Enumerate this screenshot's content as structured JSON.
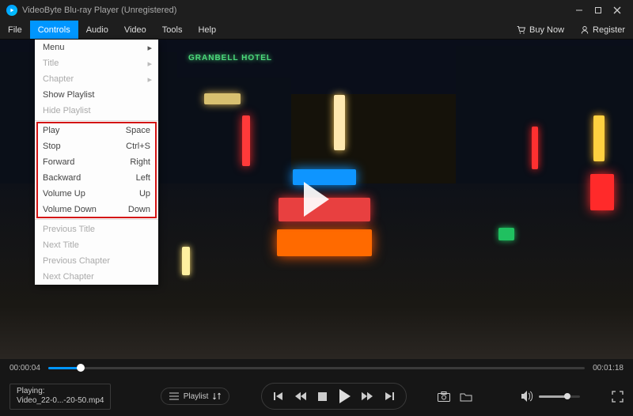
{
  "titlebar": {
    "title": "VideoByte Blu-ray Player (Unregistered)"
  },
  "menubar": {
    "items": [
      "File",
      "Controls",
      "Audio",
      "Video",
      "Tools",
      "Help"
    ],
    "active_index": 1,
    "buy": "Buy Now",
    "register": "Register"
  },
  "dropdown": {
    "rows": [
      {
        "label": "Menu",
        "submenu": true
      },
      {
        "label": "Title",
        "submenu": true,
        "disabled": true
      },
      {
        "label": "Chapter",
        "submenu": true,
        "disabled": true
      },
      {
        "label": "Show Playlist"
      },
      {
        "label": "Hide Playlist",
        "disabled": true
      },
      {
        "sep": true
      },
      {
        "label": "Play",
        "shortcut": "Space"
      },
      {
        "label": "Stop",
        "shortcut": "Ctrl+S"
      },
      {
        "label": "Forward",
        "shortcut": "Right"
      },
      {
        "label": "Backward",
        "shortcut": "Left"
      },
      {
        "label": "Volume Up",
        "shortcut": "Up"
      },
      {
        "label": "Volume Down",
        "shortcut": "Down"
      },
      {
        "sep": true
      },
      {
        "label": "Previous Title",
        "disabled": true
      },
      {
        "label": "Next Title",
        "disabled": true
      },
      {
        "label": "Previous Chapter",
        "disabled": true
      },
      {
        "label": "Next Chapter",
        "disabled": true
      }
    ],
    "highlight": {
      "from_row": 6,
      "to_row": 11
    }
  },
  "scene": {
    "hotel_sign": "GRANBELL HOTEL"
  },
  "time": {
    "current": "00:00:04",
    "total": "00:01:18",
    "progress_pct": 6
  },
  "controls": {
    "now_playing_label": "Playing:",
    "now_playing_file": "Video_22-0...-20-50.mp4",
    "playlist_label": "Playlist"
  },
  "volume": {
    "level_pct": 70
  }
}
